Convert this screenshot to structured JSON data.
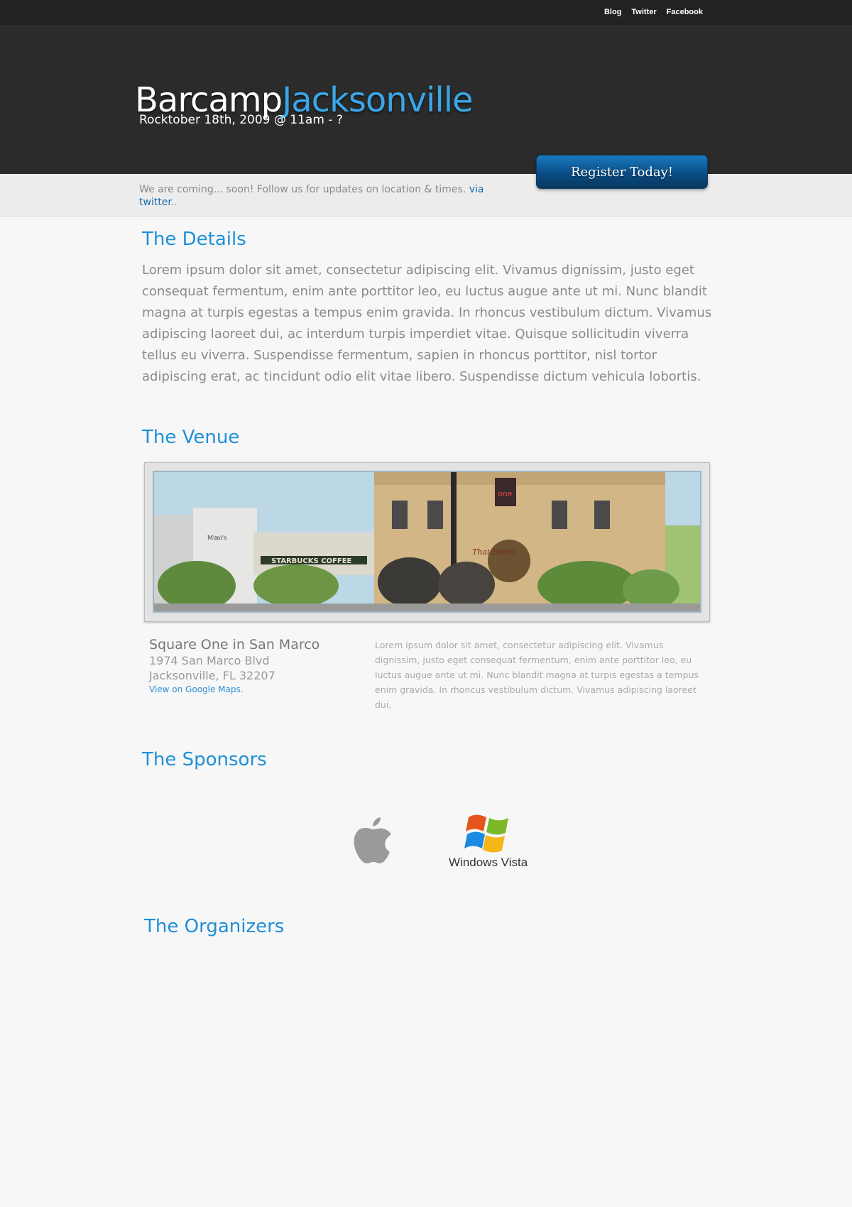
{
  "topnav": {
    "blog": "Blog",
    "twitter": "Twitter",
    "facebook": "Facebook"
  },
  "brand": {
    "part1": "Barcamp",
    "part2": "Jacksonville",
    "tagline": "Rocktober 18th, 2009 @ 11am - ?"
  },
  "register_label": "Register Today!",
  "notice": {
    "text": "We are coming... soon! Follow us for updates on location & times. ",
    "link": "via twitter",
    "suffix": ".."
  },
  "details": {
    "heading": "The Details",
    "body": "Lorem ipsum dolor sit amet, consectetur adipiscing elit. Vivamus dignissim, justo eget consequat fermentum, enim ante porttitor leo, eu luctus augue ante ut mi. Nunc blandit magna at turpis egestas a tempus enim gravida. In rhoncus vestibulum dictum. Vivamus adipiscing laoreet dui, ac interdum turpis imperdiet vitae. Quisque sollicitudin viverra tellus eu viverra. Suspendisse fermentum, sapien in rhoncus porttitor, nisl tortor adipiscing erat, ac tincidunt odio elit vitae libero. Suspendisse dictum vehicula lobortis."
  },
  "venue": {
    "heading": "The Venue",
    "photo_signs": {
      "mimis": "Mimi's",
      "starbucks": "STARBUCKS COFFEE",
      "bistro": "Thai Bistro",
      "sign": "one"
    },
    "name": "Square One in San Marco",
    "address_line1": "1974 San Marco Blvd",
    "address_line2": "Jacksonville, FL 32207",
    "map_link": "View on Google Maps.",
    "description": "Lorem ipsum dolor sit amet, consectetur adipiscing elit. Vivamus dignissim, justo eget consequat fermentum, enim ante porttitor leo, eu luctus augue ante ut mi. Nunc blandit magna at turpis egestas a tempus enim gravida. In rhoncus vestibulum dictum. Vivamus adipiscing laoreet dui,"
  },
  "sponsors": {
    "heading": "The Sponsors",
    "items": [
      {
        "icon": "apple-logo-icon"
      },
      {
        "icon": "windows-logo-icon",
        "caption": "Windows Vista"
      }
    ]
  },
  "organizers": {
    "heading": "The Organizers"
  },
  "colors": {
    "accent": "#1f8fd8",
    "header_bg": "#2b2b2b",
    "button_bg": "#0a4d85"
  }
}
